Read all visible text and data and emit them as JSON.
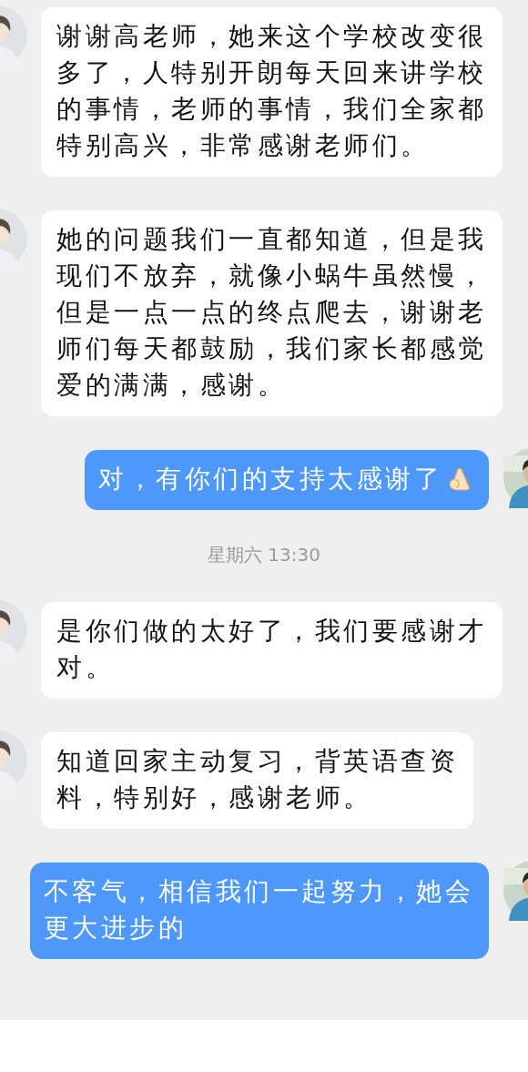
{
  "messages": [
    {
      "kind": "received",
      "lines": [
        "谢谢高老师，她来这个学校改变很",
        "多了，人特别开朗每天回来讲学校",
        "的事情，老师的事情，我们全家都",
        "特别高兴，非常感谢老师们。"
      ]
    },
    {
      "kind": "received",
      "lines": [
        "她的问题我们一直都知道，但是我",
        "现们不放弃，就像小蜗牛虽然慢，",
        "但是一点一点的终点爬去，谢谢老",
        "师们每天都鼓励，我们家长都感觉",
        "爱的满满，感谢。"
      ]
    },
    {
      "kind": "sent",
      "lines": [
        "对，有你们的支持太感谢了"
      ],
      "trailing_icon": true
    },
    {
      "kind": "time",
      "text": "星期六 13:30"
    },
    {
      "kind": "received",
      "lines": [
        "是你们做的太好了，我们要感谢才",
        "对。"
      ]
    },
    {
      "kind": "received",
      "lines": [
        "知道回家主动复习，背英语查资",
        "料，特别好，感谢老师。"
      ]
    },
    {
      "kind": "sent",
      "lines": [
        "不客气，相信我们一起努力，她会",
        "更大进步的"
      ],
      "trailing_icon": false
    }
  ]
}
